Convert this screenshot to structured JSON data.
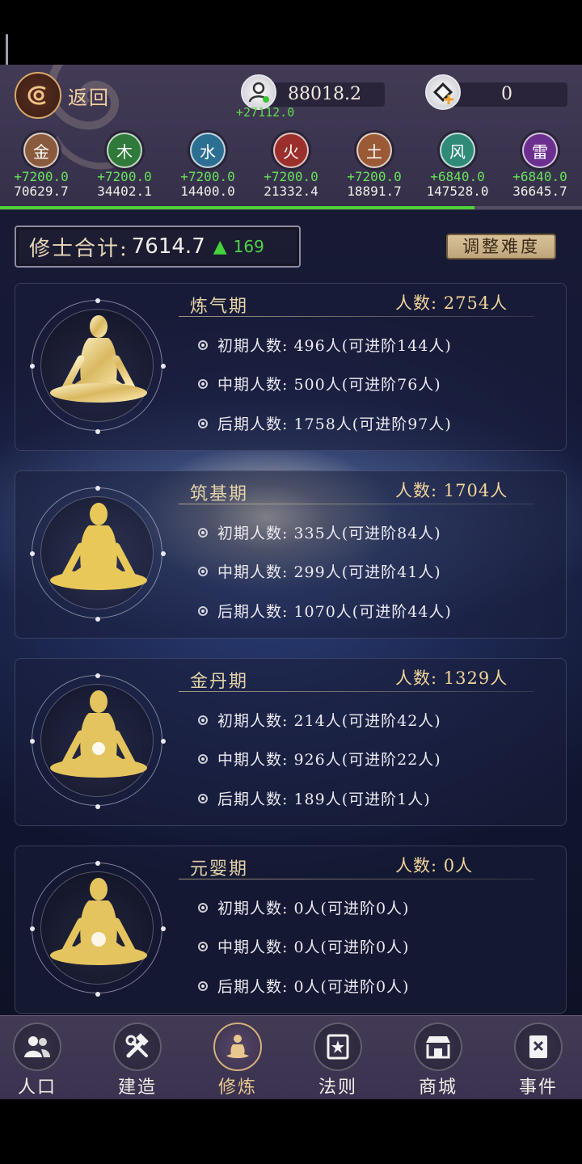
{
  "header": {
    "back_label": "返回",
    "population": "88018.2",
    "population_delta": "+27112.0",
    "spirit_stone": "0"
  },
  "elements": [
    {
      "glyph": "金",
      "delta": "+7200.0",
      "total": "70629.7",
      "color": "#8a5a3c"
    },
    {
      "glyph": "木",
      "delta": "+7200.0",
      "total": "34402.1",
      "color": "#2f7a3a"
    },
    {
      "glyph": "水",
      "delta": "+7200.0",
      "total": "14400.0",
      "color": "#2d6f93"
    },
    {
      "glyph": "火",
      "delta": "+7200.0",
      "total": "21332.4",
      "color": "#9a2f2c"
    },
    {
      "glyph": "土",
      "delta": "+7200.0",
      "total": "18891.7",
      "color": "#9a5a35"
    },
    {
      "glyph": "风",
      "delta": "+6840.0",
      "total": "147528.0",
      "color": "#2f8a78"
    },
    {
      "glyph": "雷",
      "delta": "+6840.0",
      "total": "36645.7",
      "color": "#6b2f8f"
    }
  ],
  "progress": 0.815,
  "summary": {
    "label": "修士合计:",
    "value": "7614.7",
    "increase": "169",
    "adjust_label": "调整难度"
  },
  "stages": [
    {
      "name": "炼气期",
      "count": "人数: 2754人",
      "rows": [
        "初期人数: 496人(可进阶144人)",
        "中期人数: 500人(可进阶76人)",
        "后期人数: 1758人(可进阶97人)"
      ]
    },
    {
      "name": "筑基期",
      "count": "人数: 1704人",
      "rows": [
        "初期人数: 335人(可进阶84人)",
        "中期人数: 299人(可进阶41人)",
        "后期人数: 1070人(可进阶44人)"
      ]
    },
    {
      "name": "金丹期",
      "count": "人数: 1329人",
      "rows": [
        "初期人数: 214人(可进阶42人)",
        "中期人数: 926人(可进阶22人)",
        "后期人数: 189人(可进阶1人)"
      ]
    },
    {
      "name": "元婴期",
      "count": "人数: 0人",
      "rows": [
        "初期人数: 0人(可进阶0人)",
        "中期人数: 0人(可进阶0人)",
        "后期人数: 0人(可进阶0人)"
      ]
    }
  ],
  "nav": [
    {
      "label": "人口",
      "icon": "people-icon"
    },
    {
      "label": "建造",
      "icon": "hammer-wrench-icon"
    },
    {
      "label": "修炼",
      "icon": "meditation-icon",
      "active": true
    },
    {
      "label": "法则",
      "icon": "law-scroll-icon"
    },
    {
      "label": "商城",
      "icon": "shop-icon"
    },
    {
      "label": "事件",
      "icon": "event-book-icon"
    }
  ],
  "colors": {
    "gold": "#e8c88e",
    "green": "#4fd13a",
    "panel": "#3b3450"
  }
}
